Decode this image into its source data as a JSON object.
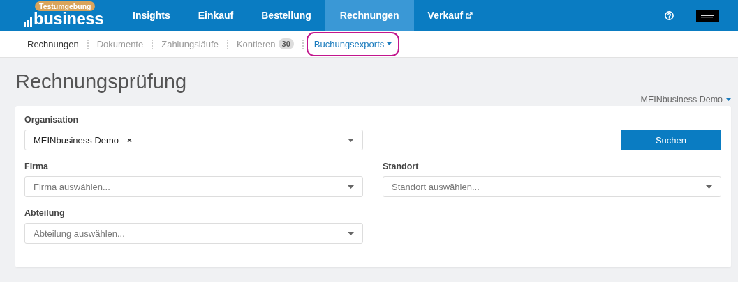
{
  "header": {
    "logo": {
      "badge": "Testumgebung",
      "text": "business"
    },
    "nav": [
      {
        "label": "Insights",
        "selected": false,
        "external": false
      },
      {
        "label": "Einkauf",
        "selected": false,
        "external": false
      },
      {
        "label": "Bestellung",
        "selected": false,
        "external": false
      },
      {
        "label": "Rechnungen",
        "selected": true,
        "external": false
      },
      {
        "label": "Verkauf",
        "selected": false,
        "external": true
      }
    ]
  },
  "subnav": [
    {
      "label": "Rechnungen",
      "selected": true,
      "kind": "link",
      "highlighted": false
    },
    {
      "label": "Dokumente",
      "selected": false,
      "kind": "link",
      "highlighted": false
    },
    {
      "label": "Zahlungsläufe",
      "selected": false,
      "kind": "link",
      "highlighted": false
    },
    {
      "label": "Kontieren",
      "selected": false,
      "kind": "link",
      "badge": "30",
      "highlighted": false
    },
    {
      "label": "Buchungsexports",
      "selected": false,
      "kind": "dropdown",
      "highlighted": true
    }
  ],
  "page": {
    "title": "Rechnungsprüfung",
    "account": "MEINbusiness Demo"
  },
  "form": [
    {
      "kind": "tags",
      "label": "Organisation",
      "tags": [
        "MEINbusiness Demo"
      ]
    },
    {
      "kind": "button",
      "label": "Suchen"
    },
    {
      "kind": "select",
      "label": "Firma",
      "placeholder": "Firma auswählen..."
    },
    {
      "kind": "select",
      "label": "Standort",
      "placeholder": "Standort auswählen..."
    },
    {
      "kind": "select",
      "label": "Abteilung",
      "placeholder": "Abteilung auswählen..."
    }
  ]
}
